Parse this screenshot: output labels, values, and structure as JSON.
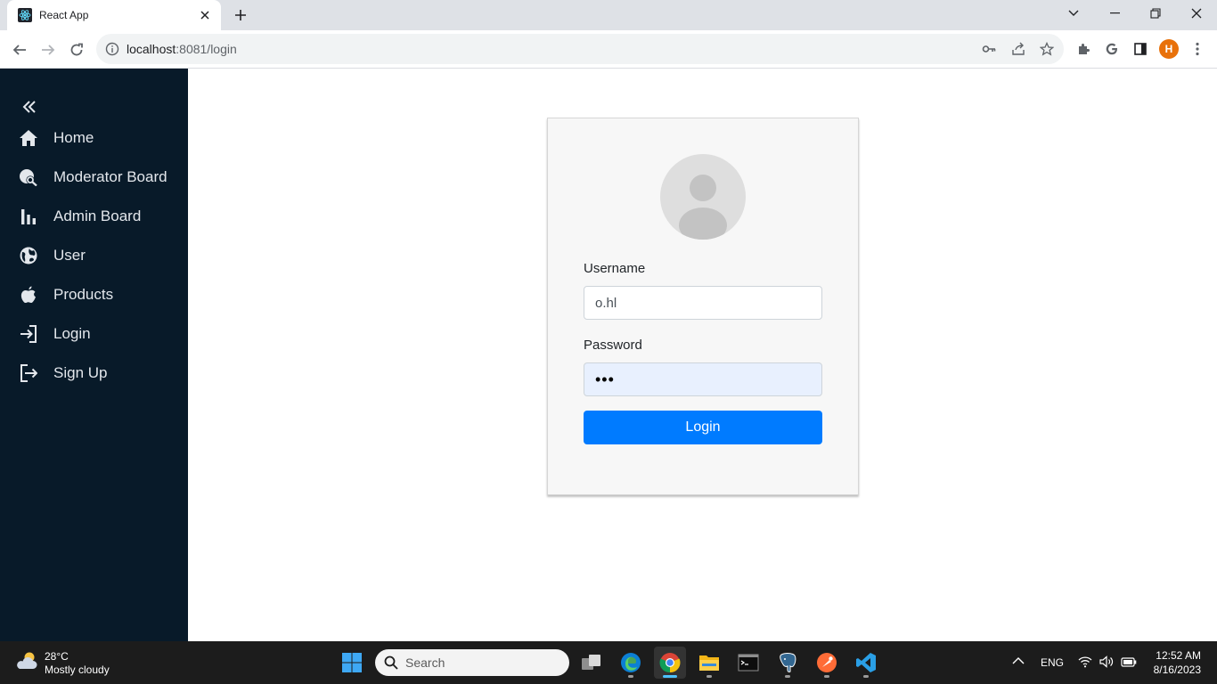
{
  "browser": {
    "tab_title": "React App",
    "url_host": "localhost",
    "url_rest": ":8081/login",
    "profile_initial": "H"
  },
  "sidebar": {
    "items": [
      {
        "label": "Home",
        "icon": "home-icon"
      },
      {
        "label": "Moderator Board",
        "icon": "globe-search-icon"
      },
      {
        "label": "Admin Board",
        "icon": "bar-chart-icon"
      },
      {
        "label": "User",
        "icon": "user-globe-icon"
      },
      {
        "label": "Products",
        "icon": "apple-icon"
      },
      {
        "label": "Login",
        "icon": "login-icon"
      },
      {
        "label": "Sign Up",
        "icon": "logout-icon"
      }
    ]
  },
  "login_form": {
    "username_label": "Username",
    "username_value": "o.hl",
    "password_label": "Password",
    "password_value": "•••",
    "submit_label": "Login"
  },
  "taskbar": {
    "weather_temp": "28°C",
    "weather_desc": "Mostly cloudy",
    "search_placeholder": "Search",
    "language": "ENG",
    "time": "12:52 AM",
    "date": "8/16/2023"
  },
  "colors": {
    "sidebar_bg": "#081a29",
    "primary_button": "#007bff",
    "autofill_bg": "#e8f0fe"
  }
}
